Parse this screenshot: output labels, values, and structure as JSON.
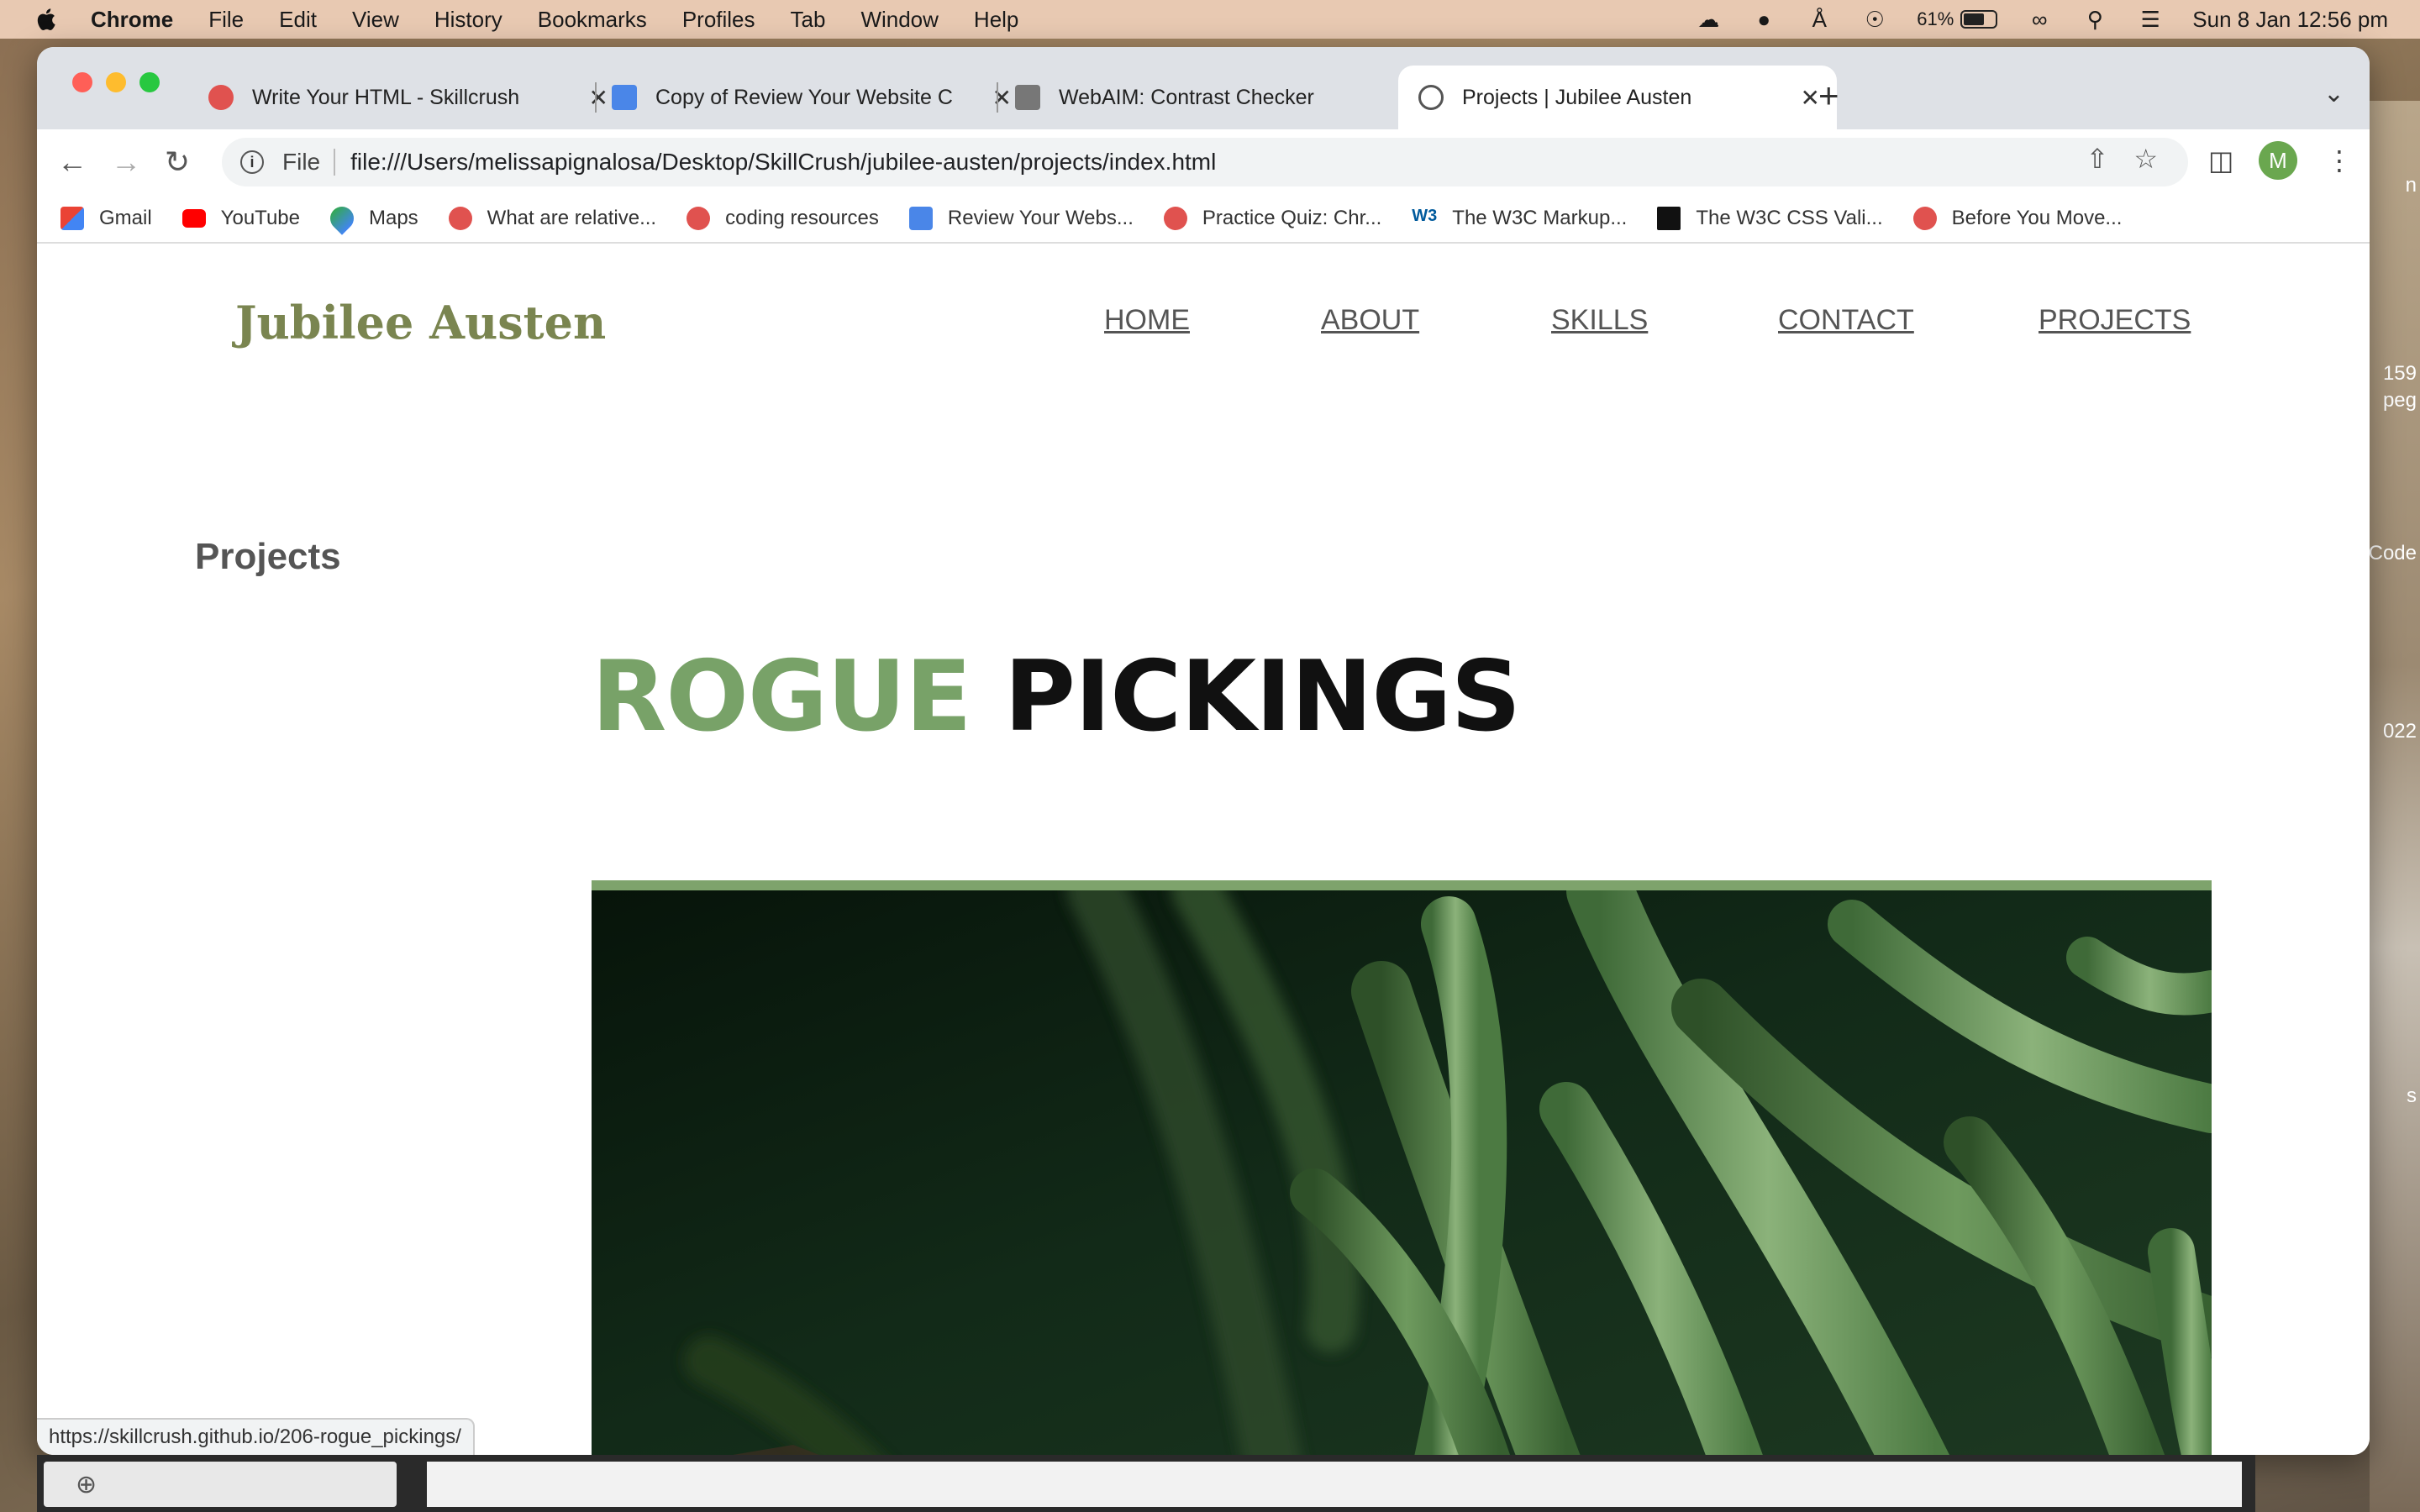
{
  "menubar": {
    "app": "Chrome",
    "items": [
      "File",
      "Edit",
      "View",
      "History",
      "Bookmarks",
      "Profiles",
      "Tab",
      "Window",
      "Help"
    ],
    "battery_percent": "61%",
    "datetime": "Sun 8 Jan  12:56 pm"
  },
  "tabs": [
    {
      "label": "Write Your HTML - Skillcrush",
      "icon": "skillcrush-icon"
    },
    {
      "label": "Copy of Review Your Website C",
      "icon": "google-docs-icon"
    },
    {
      "label": "WebAIM: Contrast Checker",
      "icon": "webaim-icon"
    },
    {
      "label": "Projects | Jubilee Austen",
      "icon": "globe-icon",
      "active": true
    }
  ],
  "omnibox": {
    "scheme": "File",
    "url": "file:///Users/melissapignalosa/Desktop/SkillCrush/jubilee-austen/projects/index.html"
  },
  "profile_initial": "M",
  "bookmarks": [
    {
      "label": "Gmail",
      "icon": "gmail-icon"
    },
    {
      "label": "YouTube",
      "icon": "youtube-icon"
    },
    {
      "label": "Maps",
      "icon": "maps-icon"
    },
    {
      "label": "What are relative...",
      "icon": "skillcrush-icon"
    },
    {
      "label": "coding resources",
      "icon": "skillcrush-icon"
    },
    {
      "label": "Review Your Webs...",
      "icon": "google-docs-icon"
    },
    {
      "label": "Practice Quiz: Chr...",
      "icon": "skillcrush-icon"
    },
    {
      "label": "The W3C Markup...",
      "icon": "w3c-icon"
    },
    {
      "label": "The W3C CSS Vali...",
      "icon": "w3c-css-icon"
    },
    {
      "label": "Before You Move...",
      "icon": "skillcrush-icon"
    }
  ],
  "site": {
    "logo": "Jubilee Austen",
    "nav": [
      "HOME",
      "ABOUT",
      "SKILLS",
      "CONTACT",
      "PROJECTS"
    ],
    "page_title": "Projects",
    "project_title_part1": "ROGUE",
    "project_title_part2": "PICKINGS"
  },
  "status_url": "https://skillcrush.github.io/206-rogue_pickings/",
  "desktop_fragments": [
    "n",
    "159",
    "peg",
    "Code",
    "022",
    "s"
  ],
  "colors": {
    "logo": "#7a8550",
    "accent_green": "#78a268",
    "nav_text": "#555555"
  }
}
